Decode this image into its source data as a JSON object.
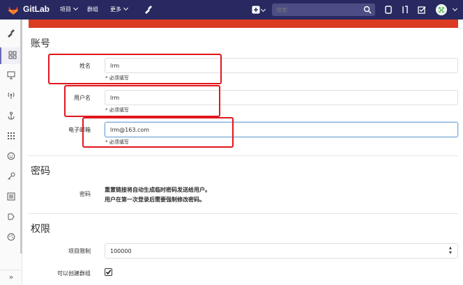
{
  "topbar": {
    "brand": "GitLab",
    "nav": [
      {
        "label": "项目"
      },
      {
        "label": "群组"
      },
      {
        "label": "更多"
      }
    ],
    "search_placeholder": "搜索"
  },
  "colors": {
    "topbar": "#292961",
    "alert_bar": "#db3b21",
    "annotation_box": "#e0161c"
  },
  "sections": {
    "account": "账号",
    "password": "密码",
    "permissions": "权限"
  },
  "account": {
    "name_label": "姓名",
    "name_value": "lrm",
    "username_label": "用户名",
    "username_value": "lrm",
    "email_label": "电子邮箱",
    "email_value": "lrm@163.com",
    "required_hint": "* 必须填写"
  },
  "password": {
    "label": "密码",
    "note_line1": "重置链接将自动生成临时密码发送给用户。",
    "note_line2": "用户在第一次登录后需要强制修改密码。"
  },
  "permissions": {
    "project_limit_label": "项目限制",
    "project_limit_value": "100000",
    "can_create_group_label": "可以创建群组",
    "can_create_group_checked": true
  },
  "sidebar": {
    "expand_label": "»",
    "icons": [
      "wrench-icon",
      "overview-icon",
      "monitoring-icon",
      "system-hooks-icon",
      "applications-icon",
      "abuse-reports-icon",
      "deploy-keys-icon",
      "service-templates-icon",
      "labels-icon",
      "appearance-icon",
      "settings-icon"
    ]
  }
}
